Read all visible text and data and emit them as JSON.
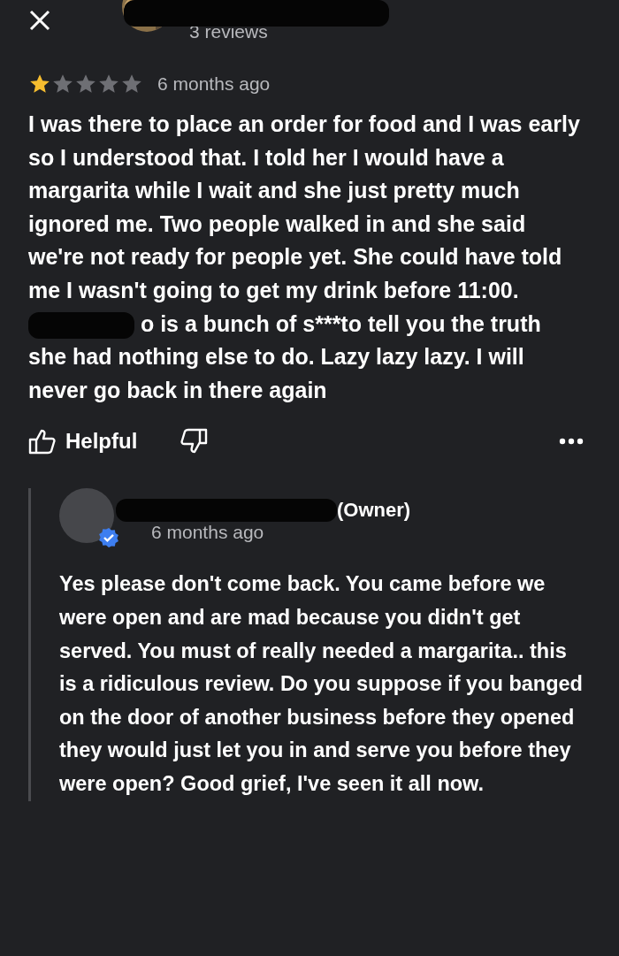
{
  "reviewer": {
    "review_count": "3 reviews"
  },
  "review": {
    "stars": 1,
    "time": "6 months ago",
    "text_before": "I was there to place an order for food and I was early so I understood that. I told her I would have a margarita while I wait and she just pretty much ignored me. Two people walked in and she said we're not ready for people yet. She could have told me I wasn't going to get my drink before 11:00.",
    "text_after": "o is a bunch of s***to tell you the truth she had nothing else to do. Lazy lazy lazy. I will never go back in there again"
  },
  "actions": {
    "helpful": "Helpful"
  },
  "owner_reply": {
    "role": "(Owner)",
    "verified": true,
    "time": "6 months ago",
    "text": "Yes please don't come back. You came before we were open and are mad because you didn't get served. You must of really needed a margarita.. this is a ridiculous review. Do you suppose if you banged on the door of another business before they opened they would just let you in and serve you before they were open? Good grief, I've seen it all now."
  }
}
